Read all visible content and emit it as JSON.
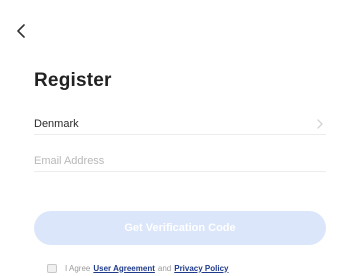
{
  "header": {
    "back_icon": "chevron-left-icon"
  },
  "title": "Register",
  "country": {
    "value": "Denmark",
    "icon": "chevron-right-icon"
  },
  "email": {
    "value": "",
    "placeholder": "Email Address"
  },
  "verification_button": {
    "label": "Get Verification Code",
    "bg_color": "#dbe6fb",
    "text_color": "#ffffff"
  },
  "agreement": {
    "prefix": "I Agree",
    "user_agreement_link": "User Agreement",
    "conjunction": "and",
    "privacy_policy_link": "Privacy Policy",
    "link_color": "#1f3a8a"
  }
}
